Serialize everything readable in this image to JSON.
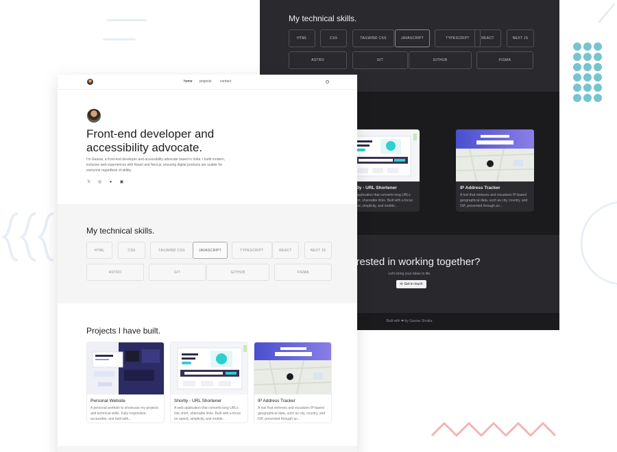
{
  "skills_heading": "My technical skills.",
  "skills": [
    {
      "label": "HTML"
    },
    {
      "label": "CSS"
    },
    {
      "label": "TAILWIND CSS"
    },
    {
      "label": "JAVASCRIPT",
      "selected": true
    },
    {
      "label": "TYPESCRIPT"
    },
    {
      "label": "REACT"
    },
    {
      "label": "NEXT JS"
    },
    {
      "label": "ASTRO"
    },
    {
      "label": "GIT"
    },
    {
      "label": "GITHUB"
    },
    {
      "label": "FIGMA"
    }
  ],
  "nav": {
    "links": [
      "home",
      "projects",
      "contact"
    ],
    "active": "home"
  },
  "hero": {
    "title": "Front-end developer and accessibility advocate.",
    "bio": "I'm Gaurav, a front-end developer and accessibility advocate based in India. I build modern, inclusive web experiences with React and Next.js, ensuring digital products are usable for everyone regardless of ability."
  },
  "socials": [
    {
      "icon": "x-icon",
      "glyph": "𝕏"
    },
    {
      "icon": "instagram-icon",
      "glyph": "◎"
    },
    {
      "icon": "github-icon",
      "glyph": "●"
    },
    {
      "icon": "linkedin-icon",
      "glyph": "▣"
    }
  ],
  "projects_heading": "Projects I have built.",
  "projects": [
    {
      "title": "Personal Website",
      "desc": "A personal portfolio to showcase my projects and technical skills. Fully responsive, accessible, and built with..."
    },
    {
      "title": "Shortly - URL Shortener",
      "desc": "A web application that converts long URLs into short, shareable links. Built with a focus on speed, simplicity, and mobile..."
    },
    {
      "title": "IP Address Tracker",
      "desc": "A tool that retrieves and visualizes IP-based geographical data, such as city, country, and ISP, presented through an..."
    }
  ],
  "cta": {
    "heading": "Interested in working together?",
    "subtext": "Let's bring your ideas to life.",
    "button": "Get in touch",
    "button_icon": "mail-icon"
  },
  "footer": {
    "text": "Built with ❤ by Gaurav Shukla."
  },
  "colors": {
    "accent_dots": "#78c3d0",
    "zigzag": "#f3b3b3",
    "dark_bg": "#29292d",
    "dark_projects_bg": "#1b1b1e"
  }
}
